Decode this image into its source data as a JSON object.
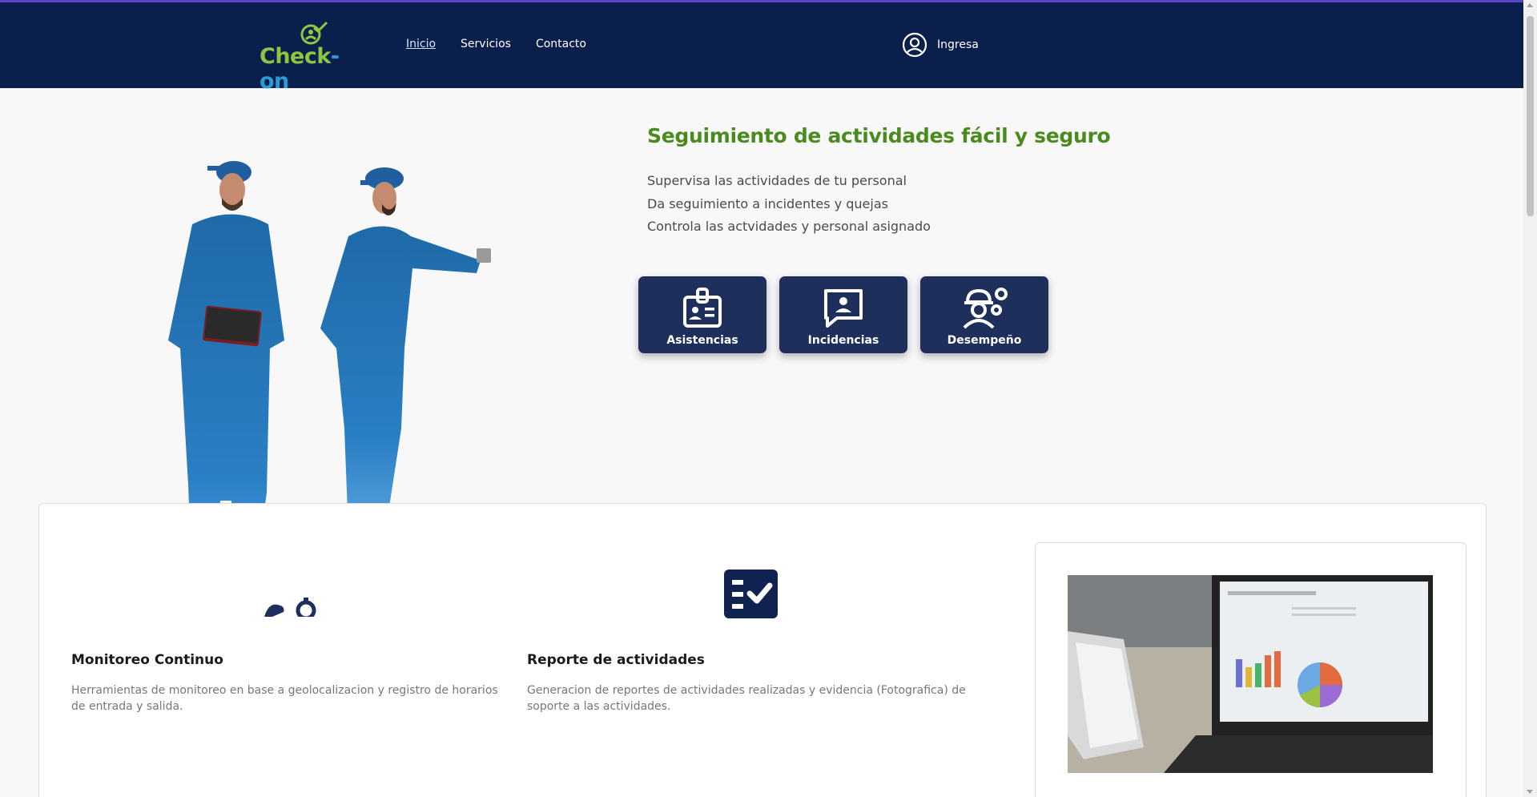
{
  "nav": {
    "logo_text_1": "Check",
    "logo_text_2": "-on",
    "links": [
      "Inicio",
      "Servicios",
      "Contacto"
    ],
    "login_label": "Ingresa"
  },
  "hero": {
    "title": "Seguimiento de actividades fácil y seguro",
    "lines": [
      "Supervisa las actividades de tu personal",
      "Da seguimiento a incidentes y quejas",
      "Controla las actvidades y personal asignado"
    ],
    "buttons": [
      "Asistencias",
      "Incidencias",
      "Desempeño"
    ]
  },
  "features": [
    {
      "title": "Monitoreo Continuo",
      "description": "Herramientas de monitoreo en base a geolocalizacion y registro de horarios de entrada y salida."
    },
    {
      "title": "Reporte de actividades",
      "description": "Generacion de reportes de actividades realizadas y evidencia (Fotografica) de soporte a las actividades."
    }
  ],
  "colors": {
    "navbar": "#0b1f4d",
    "accent_green": "#4b8a1f",
    "button_bg": "#1d2f5a"
  }
}
